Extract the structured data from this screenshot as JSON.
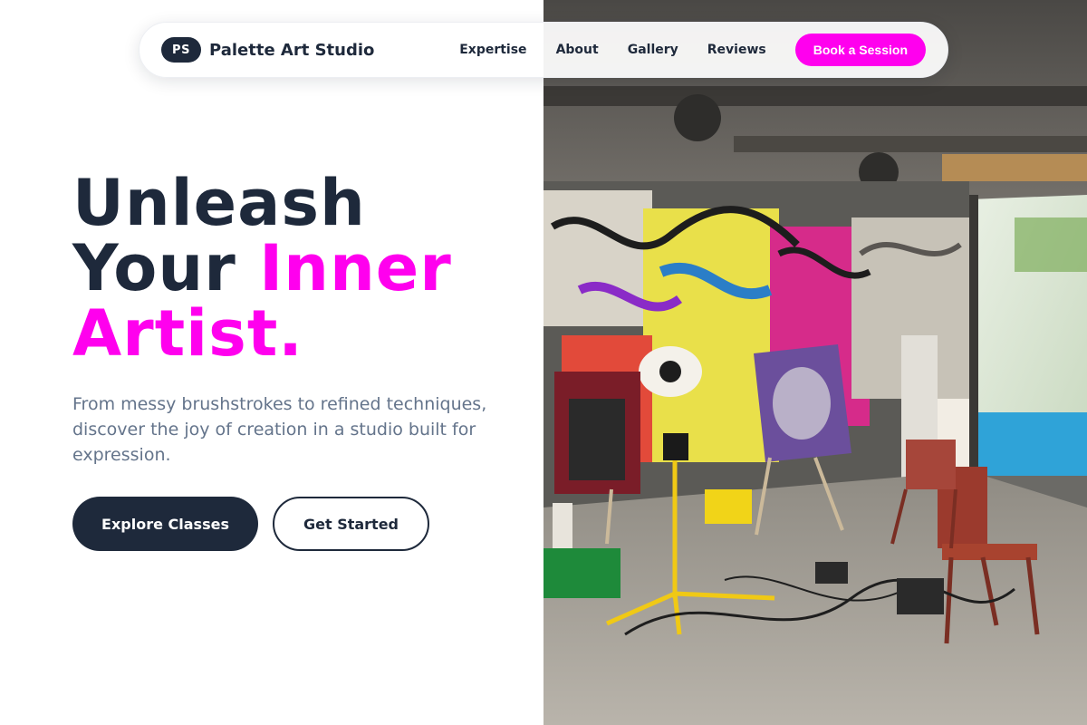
{
  "brand": {
    "logo_initials": "PS",
    "name": "Palette Art Studio"
  },
  "nav": {
    "links": [
      "Expertise",
      "About",
      "Gallery",
      "Reviews"
    ],
    "cta_label": "Book a Session"
  },
  "hero": {
    "title_line1": "Unleash",
    "title_line2_plain": "Your ",
    "title_line2_accent": "Inner",
    "title_line3_accent": "Artist.",
    "description": "From messy brushstrokes to refined techniques, discover the joy of creation in a studio built for expression.",
    "primary_button": "Explore Classes",
    "secondary_button": "Get Started"
  },
  "colors": {
    "accent": "#ff00ee",
    "dark": "#1e293b",
    "muted": "#64748b"
  },
  "image": {
    "subject": "graffiti-covered art studio with easels, canvases, chairs and work lights"
  }
}
